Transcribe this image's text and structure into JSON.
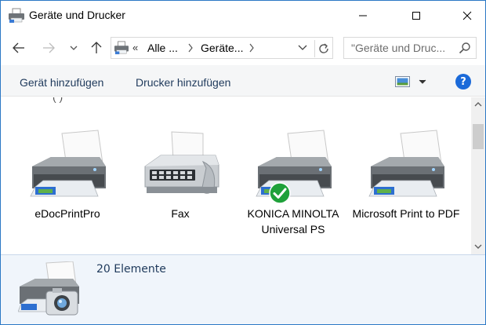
{
  "window": {
    "title": "Geräte und Drucker",
    "icon": "devices-printers-icon"
  },
  "address_bar": {
    "overflow": "«",
    "segments": [
      "Alle ...",
      "Geräte..."
    ],
    "search_placeholder": "\"Geräte und Druc..."
  },
  "commands": {
    "add_device": "Gerät hinzufügen",
    "add_printer": "Drucker hinzufügen",
    "help": "?"
  },
  "content": {
    "cut_off_text": "( )",
    "devices": [
      {
        "label": "eDocPrintPro",
        "icon": "printer-icon",
        "default": false
      },
      {
        "label": "Fax",
        "icon": "fax-icon",
        "default": false
      },
      {
        "label": "KONICA MINOLTA Universal PS",
        "icon": "printer-icon",
        "default": true
      },
      {
        "label": "Microsoft Print to PDF",
        "icon": "printer-icon",
        "default": false
      }
    ]
  },
  "details": {
    "count": "20 Elemente",
    "icon": "printer-camera-icon"
  },
  "colors": {
    "accent": "#1b6ad9",
    "command_text": "#1e395b",
    "default_check": "#1fa13a",
    "details_bg": "#f0f5fb"
  }
}
